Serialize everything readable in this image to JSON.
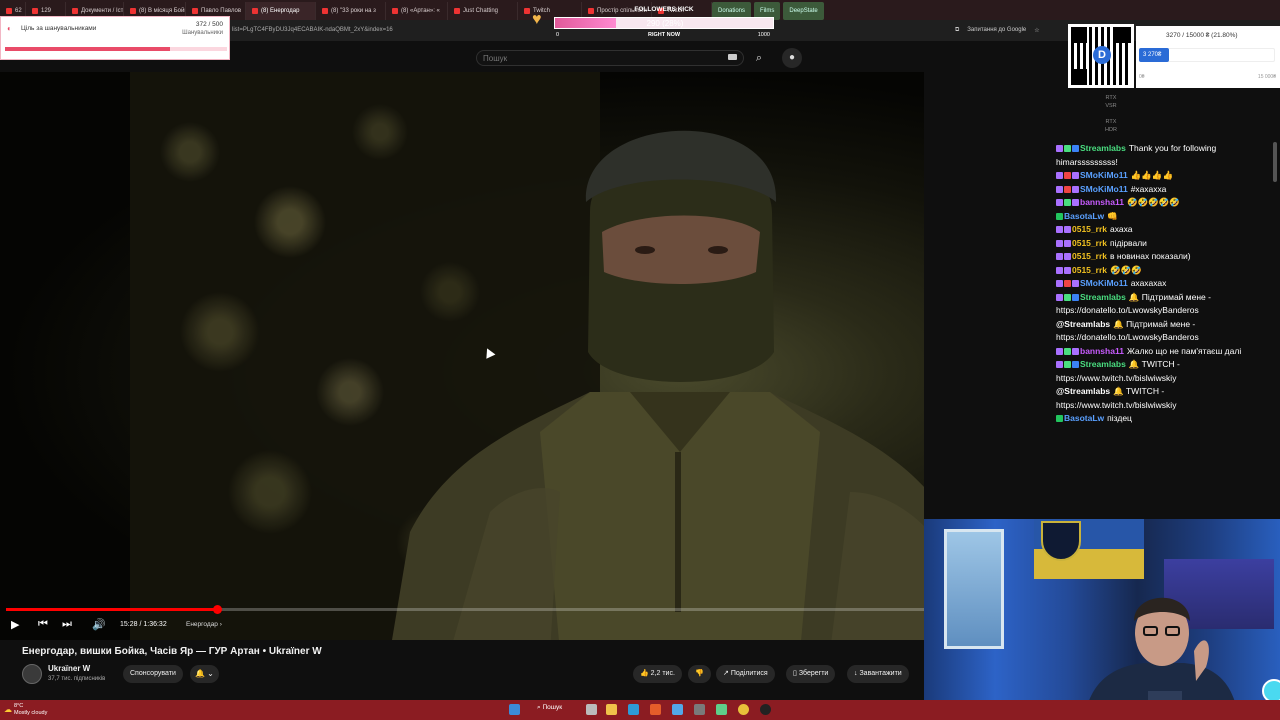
{
  "browser": {
    "tabs": [
      {
        "label": "62"
      },
      {
        "label": "129"
      },
      {
        "label": "Документи / Історія"
      },
      {
        "label": "(8) В місяця Бойко"
      },
      {
        "label": "Павло Павлов"
      },
      {
        "label": "(8) Енергодар"
      },
      {
        "label": "(8) \"33 роки на з"
      },
      {
        "label": "(8) «Артан»: «"
      },
      {
        "label": "Just Chatting"
      },
      {
        "label": "Twitch"
      },
      {
        "label": "Простір спільноти"
      },
      {
        "label": "Twitch"
      }
    ],
    "bookmark_chips": [
      "Donations",
      "Films",
      "DeepState"
    ],
    "url": "list=PLgTC4FByDU3Jq4ECABAIK-ndaQBMt_2xY&index=16",
    "ask_google": "Запитання до Google"
  },
  "youtube": {
    "search_placeholder": "Пошук",
    "player": {
      "time": "15:28 / 1:36:32",
      "chapter": "Енергодар",
      "progress_fraction": 0.23
    },
    "title": "Енергодар, вишки Бойка, Часів Яр — ГУР Артан • Ukraïner W",
    "channel": {
      "name": "Ukraïner W",
      "subs": "37,7 тис. підписників",
      "sponsor": "Спонсорувати",
      "bell": "🔔 ⌄"
    },
    "actions": {
      "likes": "2,2 тис.",
      "share": "Поділитися",
      "save": "Зберегти",
      "download": "Завантажити"
    }
  },
  "overlays": {
    "goal": {
      "label": "Ціль за шанувальниками",
      "count": "372 / 500",
      "sub": "Шанувальники",
      "fraction": 0.744
    },
    "followers_kick": {
      "title": "FOLLOWERS KICK",
      "value": "290 (28%)",
      "min": "0",
      "mid": "RIGHT NOW",
      "max": "1000",
      "fraction": 0.28
    },
    "donate": {
      "progress_text": "3270 / 15000 ₴ (21.80%)",
      "badge": "3 270₴",
      "min": "0₴",
      "max": "15 000₴",
      "fraction": 0.218
    },
    "rtx": [
      {
        "l1": "RTX",
        "l2": "VSR"
      },
      {
        "l1": "RTX",
        "l2": "HDR"
      }
    ]
  },
  "chat": [
    {
      "user": "Streamlabs",
      "color": "#4ade80",
      "text": "Thank you for following himarsssssssss!",
      "badges": [
        "#a970ff",
        "#4ade80",
        "#3b82f6"
      ]
    },
    {
      "user": "SMoKiMo11",
      "color": "#5aa0ff",
      "text": "👍👍👍👍",
      "badges": [
        "#a970ff",
        "#ef4444",
        "#a970ff"
      ]
    },
    {
      "user": "SMoKiMo11",
      "color": "#5aa0ff",
      "text": "#хахахха",
      "badges": [
        "#a970ff",
        "#ef4444",
        "#a970ff"
      ]
    },
    {
      "user": "bannsha11",
      "color": "#c85cff",
      "text": "🤣🤣🤣🤣🤣",
      "badges": [
        "#a970ff",
        "#4ade80",
        "#a970ff"
      ]
    },
    {
      "user": "BasotaLw",
      "color": "#5aa0ff",
      "text": "👊",
      "badges": [
        "#22c55e"
      ]
    },
    {
      "user": "0515_rrk",
      "color": "#f0c020",
      "text": "ахаха",
      "badges": [
        "#a970ff",
        "#a970ff"
      ]
    },
    {
      "user": "0515_rrk",
      "color": "#f0c020",
      "text": "підірвали",
      "badges": [
        "#a970ff",
        "#a970ff"
      ]
    },
    {
      "user": "0515_rrk",
      "color": "#f0c020",
      "text": "в новинах показали)",
      "badges": [
        "#a970ff",
        "#a970ff"
      ]
    },
    {
      "user": "0515_rrk",
      "color": "#f0c020",
      "text": "🤣🤣🤣",
      "badges": [
        "#a970ff",
        "#a970ff"
      ]
    },
    {
      "user": "SMoKiMo11",
      "color": "#5aa0ff",
      "text": "ахахахах",
      "badges": [
        "#a970ff",
        "#ef4444",
        "#a970ff"
      ]
    },
    {
      "user": "Streamlabs",
      "color": "#4ade80",
      "text": "🔔 Підтримай мене - https://donatello.to/LwowskyBanderos",
      "badges": [
        "#a970ff",
        "#4ade80",
        "#3b82f6"
      ]
    },
    {
      "user": "@Streamlabs",
      "color": "#ffffff",
      "text": "🔔 Підтримай мене - https://donatello.to/LwowskyBanderos",
      "badges": []
    },
    {
      "user": "bannsha11",
      "color": "#c85cff",
      "text": "Жалко що не пам'ятаєш далі",
      "badges": [
        "#a970ff",
        "#4ade80",
        "#a970ff"
      ]
    },
    {
      "user": "Streamlabs",
      "color": "#4ade80",
      "text": "🔔 TWITCH - https://www.twitch.tv/bislwiwskiy",
      "badges": [
        "#a970ff",
        "#4ade80",
        "#3b82f6"
      ]
    },
    {
      "user": "@Streamlabs",
      "color": "#ffffff",
      "text": "🔔 TWITCH - https://www.twitch.tv/bislwiwskiy",
      "badges": []
    },
    {
      "user": "BasotaLw",
      "color": "#5aa0ff",
      "text": "піздец",
      "badges": [
        "#22c55e"
      ]
    }
  ],
  "taskbar": {
    "weather_temp": "8°C",
    "weather_desc": "Mostly cloudy",
    "search": "Пошук"
  },
  "colors": {
    "accent": "#ff0000",
    "taskbar": "#8b1c22",
    "tabbar": "#2a1a1c"
  }
}
